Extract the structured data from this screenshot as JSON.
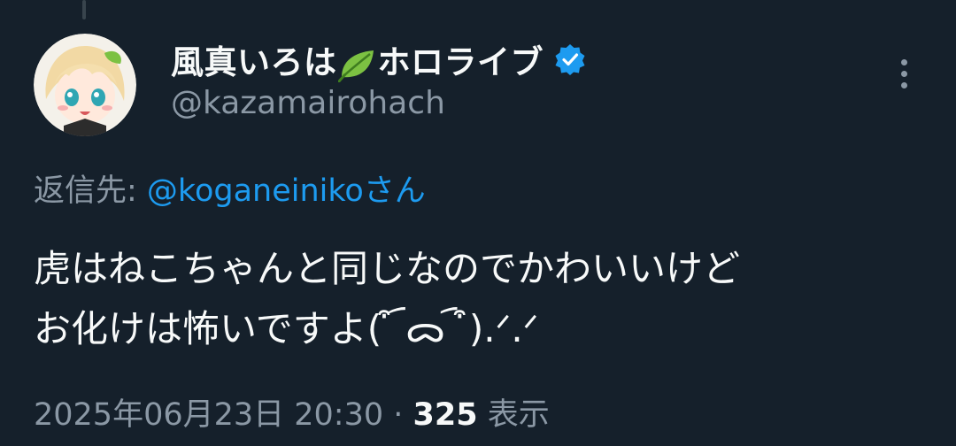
{
  "author": {
    "display_name_prefix": "風真いろは",
    "display_name_suffix": "ホロライブ",
    "handle": "@kazamairohach",
    "verified": true,
    "icons": {
      "name_emoji": "leaf-icon",
      "badge": "verified-badge-icon",
      "menu": "more-options-icon"
    }
  },
  "reply": {
    "prefix": "返信先: ",
    "mention": "@koganeinikoさん"
  },
  "tweet": {
    "lines": [
      "虎はねこちゃんと同じなのでかわいいけど",
      "お化けは怖いですよ( ͒ ︠ᯅ ︠ ͒).ᐟ.ᐟ"
    ]
  },
  "meta": {
    "timestamp": "2025年06月23日 20:30",
    "separator": " · ",
    "views_count": "325",
    "views_label": "表示"
  },
  "colors": {
    "background": "#15202b",
    "text_primary": "#f7f9f9",
    "text_secondary": "#8b98a5",
    "link": "#1d9bf0",
    "verified_badge": "#1d9bf0"
  }
}
